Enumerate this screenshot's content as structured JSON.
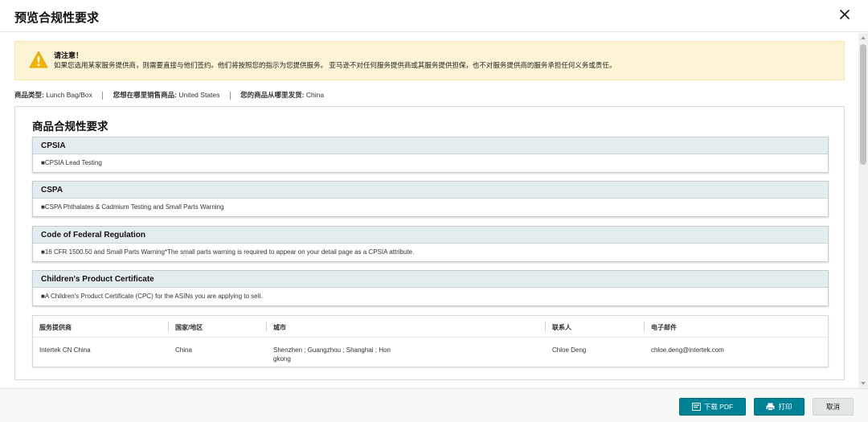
{
  "dialog": {
    "title": "预览合规性要求"
  },
  "alert": {
    "title": "请注意！",
    "text": "如果您选用某家服务提供商，则需要直接与他们签约。他们将按照您的指示为您提供服务。 亚马逊不对任何服务提供商或其服务提供担保，也不对服务提供商的服务承担任何义务或责任。"
  },
  "meta": {
    "product_type_label": "商品类型:",
    "product_type_value": "Lunch Bag/Box",
    "sell_where_label": "您想在哪里销售商品:",
    "sell_where_value": "United States",
    "ship_from_label": "您的商品从哪里发货:",
    "ship_from_value": "China"
  },
  "panel": {
    "title": "商品合规性要求"
  },
  "requirements": [
    {
      "name": "CPSIA",
      "detail": "■CPSIA Lead Testing"
    },
    {
      "name": "CSPA",
      "detail": "■CSPA Phthalates & Cadmium Testing and Small Parts Warning"
    },
    {
      "name": "Code of Federal Regulation",
      "detail": "■16 CFR 1500.50 and Small Parts Warning*The small parts warning is required to appear on your detail page as a CPSIA attribute."
    },
    {
      "name": "Children's Product Certificate",
      "detail": "■A Children's Product Certificate (CPC) for the ASINs you are applying to sell."
    }
  ],
  "providers": {
    "columns": [
      "服务提供商",
      "国家/地区",
      "城市",
      "联系人",
      "电子邮件"
    ],
    "rows": [
      {
        "provider": "Intertek CN China",
        "country": "China",
        "city_line1": "Shenzhen ; Guangzhou ; Shanghai ; Hon",
        "city_line2": "gkong",
        "contact": "Chloe Deng",
        "email": "chloe.deng@intertek.com"
      }
    ]
  },
  "footer": {
    "download_pdf": "下载 PDF",
    "print": "打印",
    "cancel": "取消"
  },
  "colors": {
    "primary_button": "#008296",
    "alert_background": "#fcf4d4",
    "warning_icon": "#f0b400",
    "section_header": "#e3ecee"
  },
  "icons": {
    "close": "close-icon",
    "warning": "warning-icon",
    "pdf": "pdf-icon",
    "print": "printer-icon"
  }
}
